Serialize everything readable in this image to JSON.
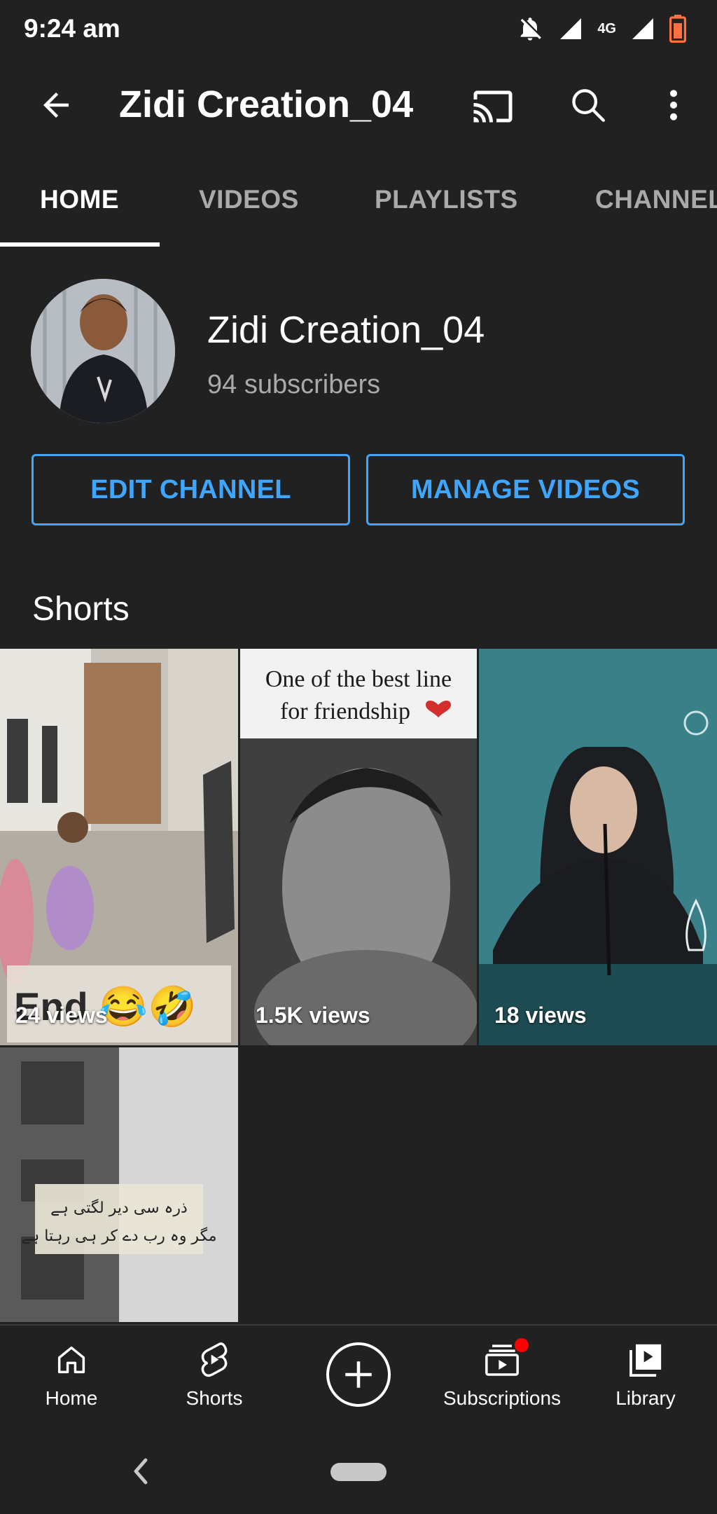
{
  "status_bar": {
    "time": "9:24 am",
    "network_label": "4G",
    "icons": [
      "notifications-off-icon",
      "signal-icon",
      "signal-icon",
      "battery-icon"
    ],
    "battery_color": "#ff7043"
  },
  "app_bar": {
    "title": "Zidi Creation_04",
    "icons": [
      "back-arrow-icon",
      "cast-icon",
      "search-icon",
      "more-vert-icon"
    ]
  },
  "tabs": [
    {
      "label": "HOME",
      "active": true
    },
    {
      "label": "VIDEOS",
      "active": false
    },
    {
      "label": "PLAYLISTS",
      "active": false
    },
    {
      "label": "CHANNEL",
      "active": false
    }
  ],
  "channel": {
    "name": "Zidi Creation_04",
    "subscribers": "94 subscribers"
  },
  "actions": {
    "edit_label": "EDIT CHANNEL",
    "manage_label": "MANAGE VIDEOS",
    "accent_color": "#3ea6ff"
  },
  "shorts": {
    "title": "Shorts",
    "items": [
      {
        "views": "24 views",
        "overlay_text": "End 😂🤣"
      },
      {
        "views": "1.5K views",
        "overlay_text": "One of the best line for friendship"
      },
      {
        "views": "18 views",
        "overlay_text": ""
      },
      {
        "views": "",
        "overlay_text": "ذرہ سی دیر لگتی ہے"
      }
    ]
  },
  "bottom_nav": {
    "items": [
      {
        "label": "Home",
        "icon": "home-icon"
      },
      {
        "label": "Shorts",
        "icon": "shorts-icon"
      },
      {
        "label": "",
        "icon": "create-icon"
      },
      {
        "label": "Subscriptions",
        "icon": "subscriptions-icon",
        "badge": true
      },
      {
        "label": "Library",
        "icon": "library-icon"
      }
    ],
    "badge_color": "#ff0000"
  }
}
